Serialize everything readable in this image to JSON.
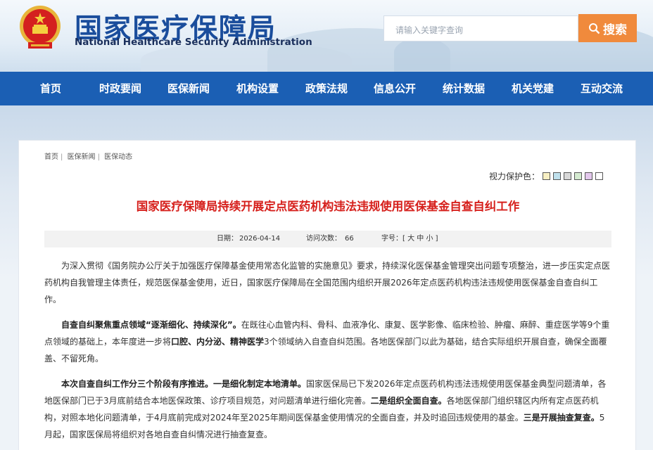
{
  "header": {
    "title": "国家医疗保障局",
    "subtitle": "National Healthcare Security Administration",
    "search_placeholder": "请输入关键字查询",
    "search_button": "搜索",
    "emblem_icon": "national-emblem-icon"
  },
  "nav": {
    "items": [
      "首页",
      "时政要闻",
      "医保新闻",
      "机构设置",
      "政策法规",
      "信息公开",
      "统计数据",
      "机关党建",
      "互动交流"
    ]
  },
  "breadcrumb": [
    "首页",
    "医保新闻",
    "医保动态"
  ],
  "eye_protect": {
    "label": "视力保护色：",
    "swatches": [
      "#f7efc3",
      "#bfe0ec",
      "#d8d8d8",
      "#d4ead0",
      "#e3c8ec",
      "#ffffff"
    ]
  },
  "article": {
    "title": "国家医疗保障局持续开展定点医药机构违法违规使用医保基金自查自纠工作",
    "date_label": "日期：",
    "date": "2026-04-14",
    "views_label": "访问次数：",
    "views": "66",
    "font_label": "字号：",
    "font_open": "[ ",
    "font_large": "大",
    "font_mid": "中",
    "font_small": "小",
    "font_close": " ]",
    "p1": "为深入贯彻《国务院办公厅关于加强医疗保障基金使用常态化监管的实施意见》要求，持续深化医保基金管理突出问题专项整治，进一步压实定点医药机构自我管理主体责任，规范医保基金使用，近日，国家医疗保障局在全国范围内组织开展2026年定点医药机构违法违规使用医保基金自查自纠工作。",
    "p2_b1": "自查自纠聚焦重点领域“逐渐细化、持续深化”。",
    "p2_t1": "在既往心血管内科、骨科、血液净化、康复、医学影像、临床检验、肿瘤、麻醉、重症医学等9个重点领域的基础上，本年度进一步将",
    "p2_b2": "口腔、内分泌、精神医学",
    "p2_t2": "3个领域纳入自查自纠范围。各地医保部门以此为基础，结合实际组织开展自查，确保全面覆盖、不留死角。",
    "p3_b1": "本次自查自纠工作分三个阶段有序推进。一是细化制定本地清单。",
    "p3_t1": "国家医保局已下发2026年定点医药机构违法违规使用医保基金典型问题清单，各地医保部门已于3月底前结合本地医保政策、诊疗项目规范，对问题清单进行细化完善。",
    "p3_b2": "二是组织全面自查。",
    "p3_t2": "各地医保部门组织辖区内所有定点医药机构，对照本地化问题清单，于4月底前完成对2024年至2025年期间医保基金使用情况的全面自查，并及时追回违规使用的基金。",
    "p3_b3": "三是开展抽查复查。",
    "p3_t3": "5月起，国家医保局将组织对各地自查自纠情况进行抽查复查。"
  }
}
